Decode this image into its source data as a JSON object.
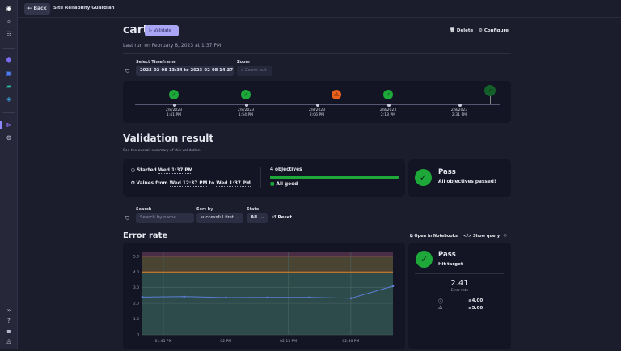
{
  "topbar": {
    "back": "Back",
    "app": "Site Reliability Guardian"
  },
  "header": {
    "title": "cart",
    "validate": "Validate",
    "delete": "Delete",
    "configure": "Configure",
    "last_run": "Last run on February 8, 2023 at 1:37 PM"
  },
  "timeframe": {
    "label": "Select Timeframe",
    "value": "2023-02-08 13:34 to 2023-02-08 14:37",
    "zoom_label": "Zoom",
    "zoom_placeholder": "Zoom out"
  },
  "timeline": [
    {
      "date": "2/8/2023",
      "time": "1:41 PM",
      "status": "pass"
    },
    {
      "date": "2/8/2023",
      "time": "1:54 PM",
      "status": "pass"
    },
    {
      "date": "2/8/2023",
      "time": "2:06 PM",
      "status": "warning"
    },
    {
      "date": "2/8/2023",
      "time": "2:18 PM",
      "status": "pass"
    },
    {
      "date": "2/8/2023",
      "time": "2:31 PM",
      "status": "pass-selected"
    }
  ],
  "validation": {
    "title": "Validation result",
    "subtitle": "See the overall summary of this validation.",
    "started_label": "Started",
    "started": "Wed 1:37 PM",
    "values_from_label": "Values from",
    "values_from": "Wed 12:37 PM",
    "to": "to",
    "values_to": "Wed 1:37 PM",
    "objectives": "4 objectives",
    "progress": 1.0,
    "all_good": "All good",
    "status": "Pass",
    "status_text": "All objectives passed!"
  },
  "filters": {
    "search_label": "Search",
    "search_placeholder": "Search by name",
    "sort_label": "Sort by",
    "sort_value": "successful first",
    "state_label": "State",
    "state_value": "All",
    "reset": "Reset"
  },
  "objective": {
    "title": "Error rate",
    "open_notebooks": "Open in Notebooks",
    "show_query": "Show query",
    "status": "Pass",
    "status_text": "Hit target",
    "value": "2.41",
    "value_label": "Error rate",
    "target": "≤4.00",
    "warning": "≤5.00"
  },
  "colors": {
    "pass": "#1fa83a",
    "warning": "#e8601c",
    "accent": "#a9a6f5",
    "line": "#5b7fd6"
  },
  "chart_data": {
    "type": "line",
    "x": [
      "01:40 PM",
      "01:50 PM",
      "02:00 PM",
      "02:10 PM",
      "02:20 PM",
      "02:30 PM",
      "02:40 PM"
    ],
    "values": [
      2.4,
      2.43,
      2.37,
      2.38,
      2.38,
      2.33,
      3.1
    ],
    "xticks": [
      "01:45 PM",
      "02 PM",
      "02:15 PM",
      "02:30 PM"
    ],
    "yticks": [
      "0",
      "1.0",
      "2.0",
      "3.0",
      "4.0",
      "5.0"
    ],
    "ylim": [
      0,
      5.3
    ],
    "thresholds": {
      "target": 4.0,
      "warning": 5.0
    },
    "grid": true
  }
}
